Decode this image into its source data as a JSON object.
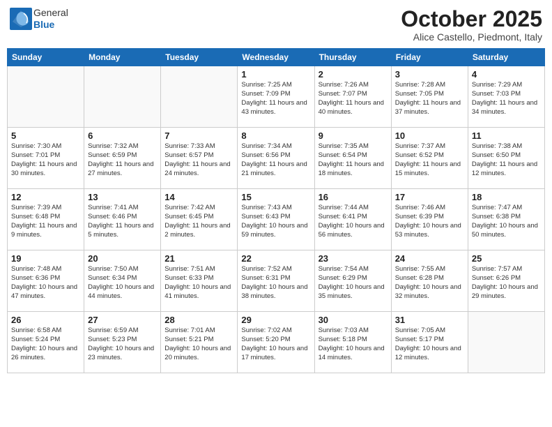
{
  "logo": {
    "general": "General",
    "blue": "Blue"
  },
  "header": {
    "month": "October 2025",
    "location": "Alice Castello, Piedmont, Italy"
  },
  "weekdays": [
    "Sunday",
    "Monday",
    "Tuesday",
    "Wednesday",
    "Thursday",
    "Friday",
    "Saturday"
  ],
  "weeks": [
    [
      {
        "day": "",
        "info": ""
      },
      {
        "day": "",
        "info": ""
      },
      {
        "day": "",
        "info": ""
      },
      {
        "day": "1",
        "info": "Sunrise: 7:25 AM\nSunset: 7:09 PM\nDaylight: 11 hours and 43 minutes."
      },
      {
        "day": "2",
        "info": "Sunrise: 7:26 AM\nSunset: 7:07 PM\nDaylight: 11 hours and 40 minutes."
      },
      {
        "day": "3",
        "info": "Sunrise: 7:28 AM\nSunset: 7:05 PM\nDaylight: 11 hours and 37 minutes."
      },
      {
        "day": "4",
        "info": "Sunrise: 7:29 AM\nSunset: 7:03 PM\nDaylight: 11 hours and 34 minutes."
      }
    ],
    [
      {
        "day": "5",
        "info": "Sunrise: 7:30 AM\nSunset: 7:01 PM\nDaylight: 11 hours and 30 minutes."
      },
      {
        "day": "6",
        "info": "Sunrise: 7:32 AM\nSunset: 6:59 PM\nDaylight: 11 hours and 27 minutes."
      },
      {
        "day": "7",
        "info": "Sunrise: 7:33 AM\nSunset: 6:57 PM\nDaylight: 11 hours and 24 minutes."
      },
      {
        "day": "8",
        "info": "Sunrise: 7:34 AM\nSunset: 6:56 PM\nDaylight: 11 hours and 21 minutes."
      },
      {
        "day": "9",
        "info": "Sunrise: 7:35 AM\nSunset: 6:54 PM\nDaylight: 11 hours and 18 minutes."
      },
      {
        "day": "10",
        "info": "Sunrise: 7:37 AM\nSunset: 6:52 PM\nDaylight: 11 hours and 15 minutes."
      },
      {
        "day": "11",
        "info": "Sunrise: 7:38 AM\nSunset: 6:50 PM\nDaylight: 11 hours and 12 minutes."
      }
    ],
    [
      {
        "day": "12",
        "info": "Sunrise: 7:39 AM\nSunset: 6:48 PM\nDaylight: 11 hours and 9 minutes."
      },
      {
        "day": "13",
        "info": "Sunrise: 7:41 AM\nSunset: 6:46 PM\nDaylight: 11 hours and 5 minutes."
      },
      {
        "day": "14",
        "info": "Sunrise: 7:42 AM\nSunset: 6:45 PM\nDaylight: 11 hours and 2 minutes."
      },
      {
        "day": "15",
        "info": "Sunrise: 7:43 AM\nSunset: 6:43 PM\nDaylight: 10 hours and 59 minutes."
      },
      {
        "day": "16",
        "info": "Sunrise: 7:44 AM\nSunset: 6:41 PM\nDaylight: 10 hours and 56 minutes."
      },
      {
        "day": "17",
        "info": "Sunrise: 7:46 AM\nSunset: 6:39 PM\nDaylight: 10 hours and 53 minutes."
      },
      {
        "day": "18",
        "info": "Sunrise: 7:47 AM\nSunset: 6:38 PM\nDaylight: 10 hours and 50 minutes."
      }
    ],
    [
      {
        "day": "19",
        "info": "Sunrise: 7:48 AM\nSunset: 6:36 PM\nDaylight: 10 hours and 47 minutes."
      },
      {
        "day": "20",
        "info": "Sunrise: 7:50 AM\nSunset: 6:34 PM\nDaylight: 10 hours and 44 minutes."
      },
      {
        "day": "21",
        "info": "Sunrise: 7:51 AM\nSunset: 6:33 PM\nDaylight: 10 hours and 41 minutes."
      },
      {
        "day": "22",
        "info": "Sunrise: 7:52 AM\nSunset: 6:31 PM\nDaylight: 10 hours and 38 minutes."
      },
      {
        "day": "23",
        "info": "Sunrise: 7:54 AM\nSunset: 6:29 PM\nDaylight: 10 hours and 35 minutes."
      },
      {
        "day": "24",
        "info": "Sunrise: 7:55 AM\nSunset: 6:28 PM\nDaylight: 10 hours and 32 minutes."
      },
      {
        "day": "25",
        "info": "Sunrise: 7:57 AM\nSunset: 6:26 PM\nDaylight: 10 hours and 29 minutes."
      }
    ],
    [
      {
        "day": "26",
        "info": "Sunrise: 6:58 AM\nSunset: 5:24 PM\nDaylight: 10 hours and 26 minutes."
      },
      {
        "day": "27",
        "info": "Sunrise: 6:59 AM\nSunset: 5:23 PM\nDaylight: 10 hours and 23 minutes."
      },
      {
        "day": "28",
        "info": "Sunrise: 7:01 AM\nSunset: 5:21 PM\nDaylight: 10 hours and 20 minutes."
      },
      {
        "day": "29",
        "info": "Sunrise: 7:02 AM\nSunset: 5:20 PM\nDaylight: 10 hours and 17 minutes."
      },
      {
        "day": "30",
        "info": "Sunrise: 7:03 AM\nSunset: 5:18 PM\nDaylight: 10 hours and 14 minutes."
      },
      {
        "day": "31",
        "info": "Sunrise: 7:05 AM\nSunset: 5:17 PM\nDaylight: 10 hours and 12 minutes."
      },
      {
        "day": "",
        "info": ""
      }
    ]
  ]
}
